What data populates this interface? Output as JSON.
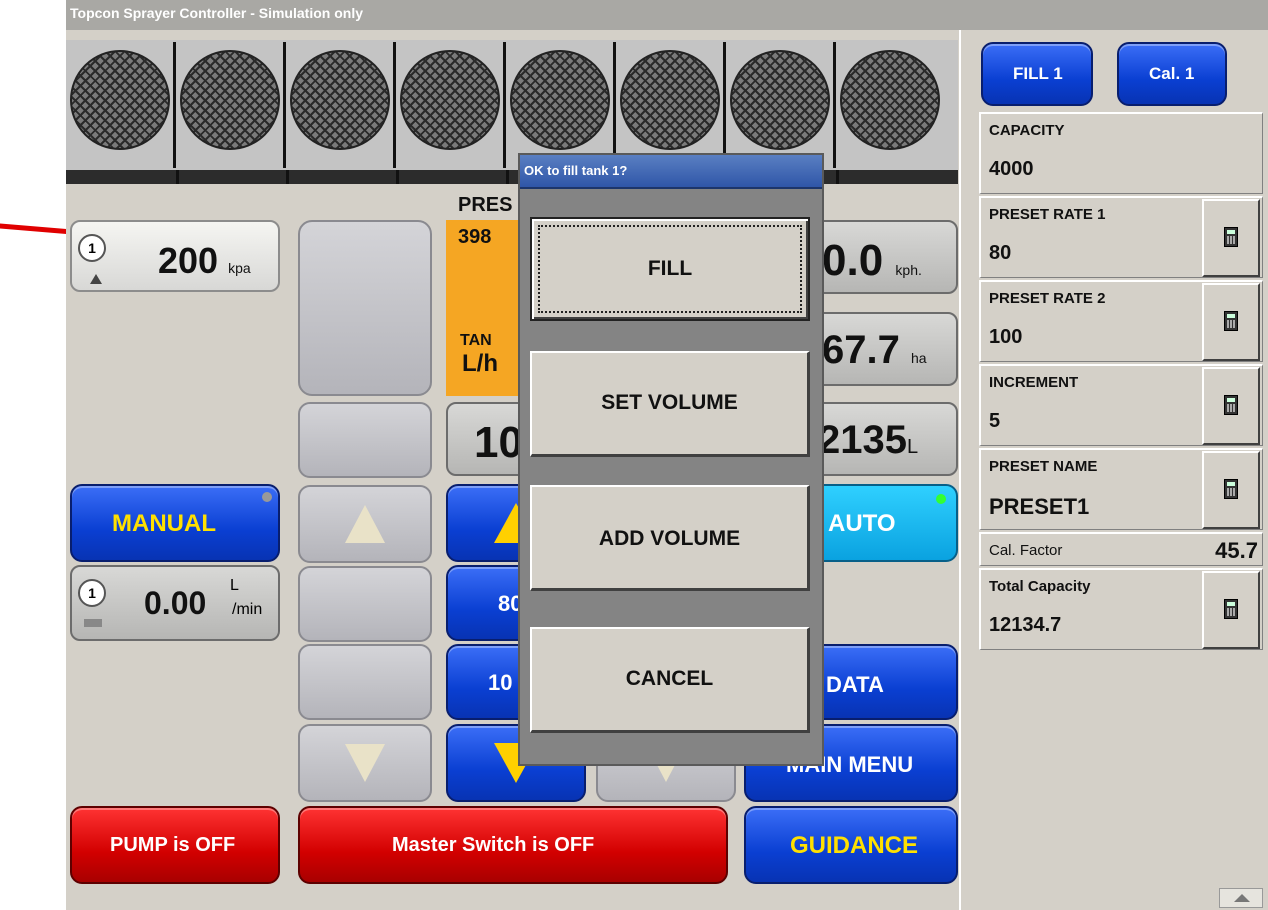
{
  "window": {
    "title": "Topcon Sprayer Controller  - Simulation only"
  },
  "pressure_gauge": {
    "number": "1",
    "value": "200",
    "unit": "kpa"
  },
  "preset_panel": {
    "label": "PRES",
    "value": "398",
    "tank_label": "TAN",
    "unit": "L/h"
  },
  "speed_gauge": {
    "value": "0.0",
    "unit": "kph."
  },
  "area_gauge": {
    "value": "67.7",
    "unit": "ha"
  },
  "rate_display": {
    "value": "10"
  },
  "tank_volume": {
    "value": "2135",
    "unit": "L"
  },
  "buttons": {
    "manual": "MANUAL",
    "auto": "AUTO",
    "preset_80": "80",
    "preset_100": "10",
    "data": "DATA",
    "main_menu": "MAIN MENU",
    "pump": "PUMP is OFF",
    "master_switch": "Master Switch is OFF",
    "guidance": "GUIDANCE"
  },
  "flow_gauge": {
    "number": "1",
    "value": "0.00",
    "unit_top": "L",
    "unit_bottom": "/min"
  },
  "right_panel": {
    "tabs": [
      "FILL 1",
      "Cal. 1"
    ],
    "capacity": {
      "label": "CAPACITY",
      "value": "4000"
    },
    "preset_rate_1": {
      "label": "PRESET RATE 1",
      "value": "80"
    },
    "preset_rate_2": {
      "label": "PRESET RATE 2",
      "value": "100"
    },
    "increment": {
      "label": "INCREMENT",
      "value": "5"
    },
    "preset_name": {
      "label": "PRESET NAME",
      "value": "PRESET1"
    },
    "cal_factor": {
      "label": "Cal. Factor",
      "value": "45.7"
    },
    "total_capacity": {
      "label": "Total Capacity",
      "value": "12134.7"
    }
  },
  "dialog": {
    "title": "OK to fill tank 1?",
    "buttons": [
      "FILL",
      "SET VOLUME",
      "ADD VOLUME",
      "CANCEL"
    ]
  },
  "colors": {
    "arrow": "#e00000",
    "preset_panel": "#f5a623",
    "blue_button": "#0a3fd2",
    "red_button": "#d20000"
  }
}
